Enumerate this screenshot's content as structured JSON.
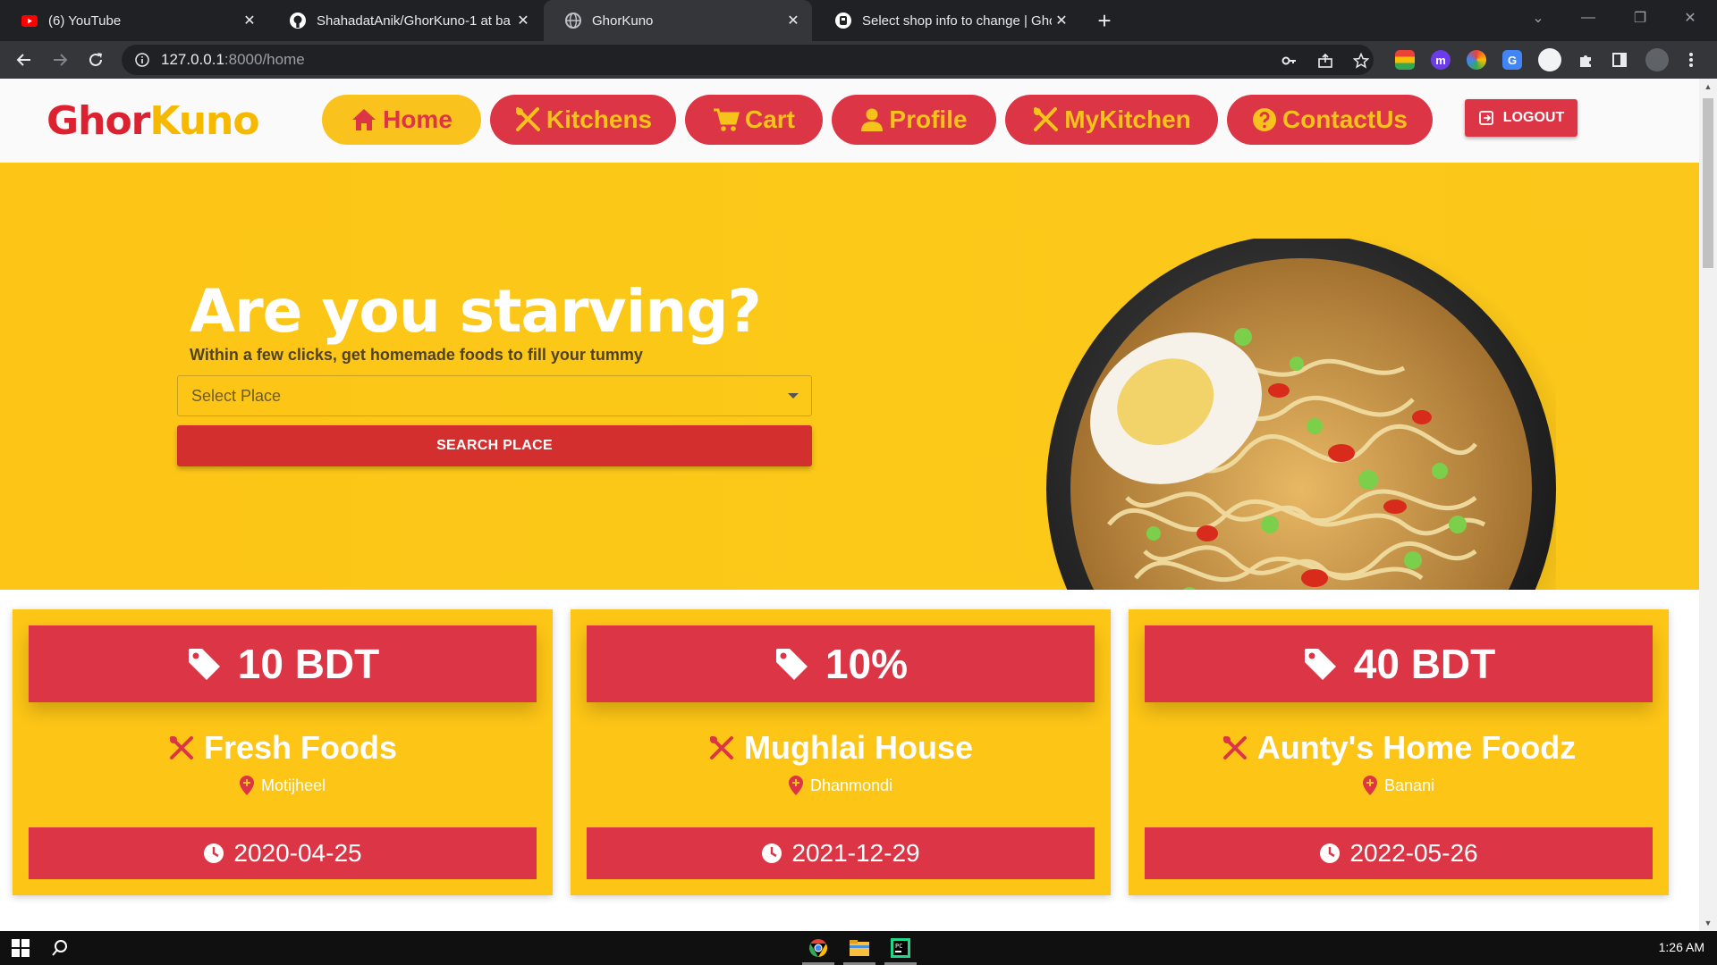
{
  "browser": {
    "tabs": [
      {
        "title": "(6) YouTube",
        "icon": "youtube-icon"
      },
      {
        "title": "ShahadatAnik/GhorKuno-1 at ba",
        "icon": "github-icon"
      },
      {
        "title": "GhorKuno",
        "icon": "globe-icon"
      },
      {
        "title": "Select shop info to change | Ghor",
        "icon": "django-icon"
      }
    ],
    "url_host": "127.0.0.1",
    "url_path": ":8000/home"
  },
  "site": {
    "logo_part1": "Ghor",
    "logo_part2": "Kuno",
    "nav": [
      {
        "label": "Home",
        "icon": "home-icon"
      },
      {
        "label": "Kitchens",
        "icon": "utensils-icon"
      },
      {
        "label": "Cart",
        "icon": "cart-icon"
      },
      {
        "label": "Profile",
        "icon": "user-icon"
      },
      {
        "label": "MyKitchen",
        "icon": "utensils-icon"
      },
      {
        "label": "ContactUs",
        "icon": "question-icon"
      }
    ],
    "logout_label": "LOGOUT"
  },
  "hero": {
    "title": "Are you starving?",
    "subtitle": "Within a few clicks, get homemade foods to fill your tummy",
    "select_placeholder": "Select Place",
    "search_label": "SEARCH PLACE"
  },
  "offers": [
    {
      "discount": "10 BDT",
      "shop": "Fresh Foods",
      "location": "Motijheel",
      "date": "2020-04-25"
    },
    {
      "discount": "10%",
      "shop": "Mughlai House",
      "location": "Dhanmondi",
      "date": "2021-12-29"
    },
    {
      "discount": "40 BDT",
      "shop": "Aunty's Home Foodz",
      "location": "Banani",
      "date": "2022-05-26"
    }
  ],
  "taskbar": {
    "time": "1:26 AM"
  },
  "colors": {
    "brand_red": "#dc3545",
    "brand_yellow": "#fdc516"
  }
}
